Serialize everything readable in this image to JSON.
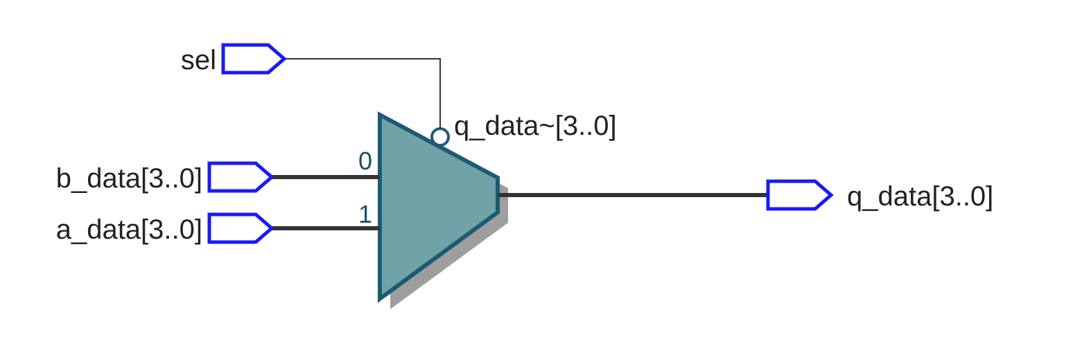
{
  "diagram": {
    "instance_name": "q_data~[3..0]",
    "mux": {
      "type": "2:1 multiplexer",
      "width": 4,
      "select_inverted": true,
      "input0_label": "0",
      "input1_label": "1"
    },
    "ports": {
      "sel": {
        "direction": "input",
        "label": "sel"
      },
      "b_data": {
        "direction": "input",
        "label": "b_data[3..0]"
      },
      "a_data": {
        "direction": "input",
        "label": "a_data[3..0]"
      },
      "q_data": {
        "direction": "output",
        "label": "q_data[3..0]"
      }
    },
    "connections": [
      {
        "from": "sel",
        "to": "mux.sel"
      },
      {
        "from": "b_data",
        "to": "mux.in0"
      },
      {
        "from": "a_data",
        "to": "mux.in1"
      },
      {
        "from": "mux.out",
        "to": "q_data"
      }
    ],
    "colors": {
      "port_stroke": "#1a1af5",
      "wire_thin": "#333333",
      "wire_bus": "#333333",
      "mux_fill": "#6fa3a8",
      "mux_stroke": "#1d5a73",
      "shadow": "#9e9e9e"
    }
  }
}
